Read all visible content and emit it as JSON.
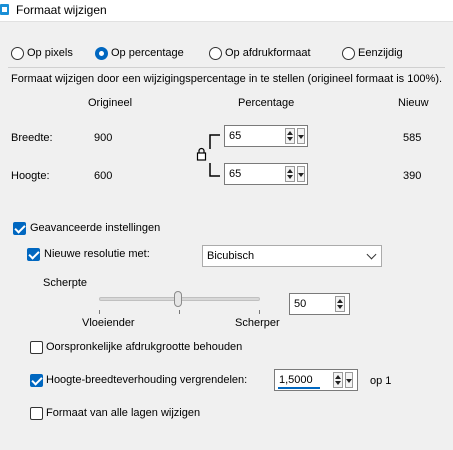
{
  "window": {
    "title": "Formaat wijzigen"
  },
  "modes": [
    {
      "label": "Op pixels",
      "checked": false
    },
    {
      "label": "Op percentage",
      "checked": true
    },
    {
      "label": "Op afdrukformaat",
      "checked": false
    },
    {
      "label": "Eenzijdig",
      "checked": false
    }
  ],
  "description": "Formaat wijzigen door een wijzigingspercentage in te stellen (origineel formaat  is 100%).",
  "columns": {
    "original": "Origineel",
    "percentage": "Percentage",
    "new": "Nieuw"
  },
  "rows": {
    "width": {
      "label": "Breedte:",
      "original": "900",
      "percentage": "65",
      "new": "585"
    },
    "height": {
      "label": "Hoogte:",
      "original": "600",
      "percentage": "65",
      "new": "390"
    }
  },
  "advanced": {
    "label": "Geavanceerde instellingen",
    "checked": true,
    "resample": {
      "label": "Nieuwe resolutie met:",
      "checked": true,
      "method": "Bicubisch"
    },
    "sharpness": {
      "label": "Scherpte",
      "value": "50",
      "left_label": "Vloeiender",
      "right_label": "Scherper",
      "level": 0.5
    },
    "keep_print_size": {
      "label": "Oorspronkelijke afdrukgrootte behouden",
      "checked": false
    },
    "lock_ratio": {
      "label": "Hoogte-breedteverhouding vergrendelen:",
      "checked": true,
      "value": "1,5000",
      "suffix": "op 1"
    },
    "all_layers": {
      "label": "Formaat van alle lagen wijzigen",
      "checked": false
    }
  },
  "colors": {
    "accent": "#0067c0"
  },
  "icons": {
    "app": "resize-app-icon",
    "lock": "lock-icon"
  }
}
